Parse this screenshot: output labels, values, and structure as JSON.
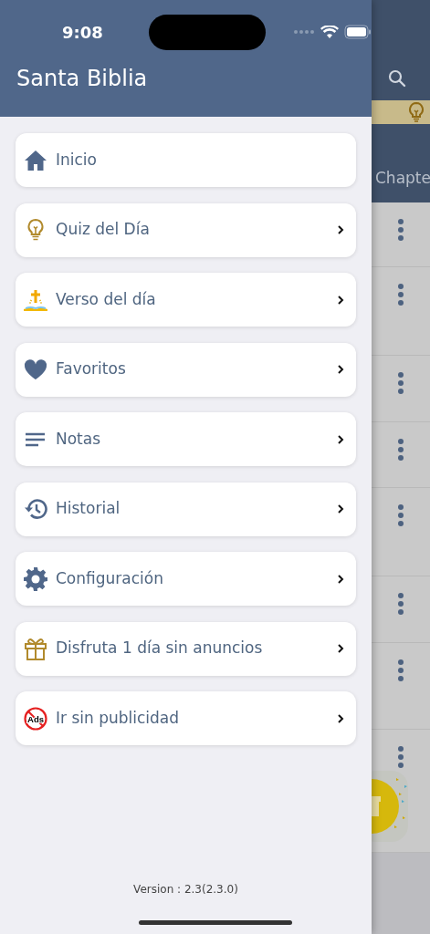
{
  "status_bar": {
    "time": "9:08"
  },
  "drawer": {
    "title": "Santa Biblia",
    "items": [
      {
        "kind": "home",
        "label": "Inicio",
        "chevron": false
      },
      {
        "kind": "bulb",
        "label": "Quiz del Día",
        "chevron": true
      },
      {
        "kind": "bible",
        "label": "Verso del día",
        "chevron": true
      },
      {
        "kind": "heart",
        "label": "Favoritos",
        "chevron": true
      },
      {
        "kind": "lines",
        "label": "Notas",
        "chevron": true
      },
      {
        "kind": "history",
        "label": "Historial",
        "chevron": true
      },
      {
        "kind": "gear",
        "label": "Configuración",
        "chevron": true
      },
      {
        "kind": "gift",
        "label": "Disfruta 1 día sin anuncios",
        "chevron": true
      },
      {
        "kind": "noads",
        "label": "Ir sin publicidad",
        "chevron": true,
        "icon_text": "Ads"
      }
    ],
    "version": "Version : 2.3(2.3.0)"
  },
  "background_screen": {
    "column_header": "Chapte"
  }
}
